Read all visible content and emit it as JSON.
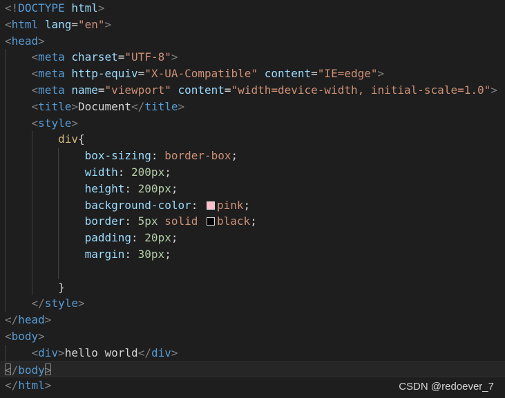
{
  "editor": {
    "lines": [
      {
        "tokens": [
          [
            "punc",
            "<!"
          ],
          [
            "tag",
            "DOCTYPE"
          ],
          [
            "text",
            " "
          ],
          [
            "attr",
            "html"
          ],
          [
            "punc",
            ">"
          ]
        ]
      },
      {
        "tokens": [
          [
            "punc",
            "<"
          ],
          [
            "tag",
            "html"
          ],
          [
            "text",
            " "
          ],
          [
            "attr",
            "lang"
          ],
          [
            "text",
            "="
          ],
          [
            "str",
            "\"en\""
          ],
          [
            "punc",
            ">"
          ]
        ]
      },
      {
        "tokens": [
          [
            "punc",
            "<"
          ],
          [
            "tag",
            "head"
          ],
          [
            "punc",
            ">"
          ]
        ]
      },
      {
        "tokens": [
          [
            "text",
            "    "
          ],
          [
            "punc",
            "<"
          ],
          [
            "tag",
            "meta"
          ],
          [
            "text",
            " "
          ],
          [
            "attr",
            "charset"
          ],
          [
            "text",
            "="
          ],
          [
            "str",
            "\"UTF-8\""
          ],
          [
            "punc",
            ">"
          ]
        ]
      },
      {
        "tokens": [
          [
            "text",
            "    "
          ],
          [
            "punc",
            "<"
          ],
          [
            "tag",
            "meta"
          ],
          [
            "text",
            " "
          ],
          [
            "attr",
            "http-equiv"
          ],
          [
            "text",
            "="
          ],
          [
            "str",
            "\"X-UA-Compatible\""
          ],
          [
            "text",
            " "
          ],
          [
            "attr",
            "content"
          ],
          [
            "text",
            "="
          ],
          [
            "str",
            "\"IE=edge\""
          ],
          [
            "punc",
            ">"
          ]
        ]
      },
      {
        "tokens": [
          [
            "text",
            "    "
          ],
          [
            "punc",
            "<"
          ],
          [
            "tag",
            "meta"
          ],
          [
            "text",
            " "
          ],
          [
            "attr",
            "name"
          ],
          [
            "text",
            "="
          ],
          [
            "str",
            "\"viewport\""
          ],
          [
            "text",
            " "
          ],
          [
            "attr",
            "content"
          ],
          [
            "text",
            "="
          ],
          [
            "str",
            "\"width=device-width, initial-scale=1.0\""
          ],
          [
            "punc",
            ">"
          ]
        ]
      },
      {
        "tokens": [
          [
            "text",
            "    "
          ],
          [
            "punc",
            "<"
          ],
          [
            "tag",
            "title"
          ],
          [
            "punc",
            ">"
          ],
          [
            "text",
            "Document"
          ],
          [
            "punc",
            "</"
          ],
          [
            "tag",
            "title"
          ],
          [
            "punc",
            ">"
          ]
        ]
      },
      {
        "tokens": [
          [
            "text",
            "    "
          ],
          [
            "punc",
            "<"
          ],
          [
            "tag",
            "style"
          ],
          [
            "punc",
            ">"
          ]
        ]
      },
      {
        "tokens": [
          [
            "text",
            "        "
          ],
          [
            "sel",
            "div"
          ],
          [
            "text",
            "{"
          ]
        ]
      },
      {
        "tokens": [
          [
            "text",
            "            "
          ],
          [
            "prop",
            "box-sizing"
          ],
          [
            "text",
            ": "
          ],
          [
            "val",
            "border-box"
          ],
          [
            "text",
            ";"
          ]
        ]
      },
      {
        "tokens": [
          [
            "text",
            "            "
          ],
          [
            "prop",
            "width"
          ],
          [
            "text",
            ": "
          ],
          [
            "num",
            "200px"
          ],
          [
            "text",
            ";"
          ]
        ]
      },
      {
        "tokens": [
          [
            "text",
            "            "
          ],
          [
            "prop",
            "height"
          ],
          [
            "text",
            ": "
          ],
          [
            "num",
            "200px"
          ],
          [
            "text",
            ";"
          ]
        ]
      },
      {
        "tokens": [
          [
            "text",
            "            "
          ],
          [
            "prop",
            "background-color"
          ],
          [
            "text",
            ": "
          ],
          [
            "swatch",
            "pink"
          ],
          [
            "val",
            "pink"
          ],
          [
            "text",
            ";"
          ]
        ]
      },
      {
        "tokens": [
          [
            "text",
            "            "
          ],
          [
            "prop",
            "border"
          ],
          [
            "text",
            ": "
          ],
          [
            "num",
            "5px"
          ],
          [
            "text",
            " "
          ],
          [
            "val",
            "solid"
          ],
          [
            "text",
            " "
          ],
          [
            "swatch",
            "black"
          ],
          [
            "val",
            "black"
          ],
          [
            "text",
            ";"
          ]
        ]
      },
      {
        "tokens": [
          [
            "text",
            "            "
          ],
          [
            "prop",
            "padding"
          ],
          [
            "text",
            ": "
          ],
          [
            "num",
            "20px"
          ],
          [
            "text",
            ";"
          ]
        ]
      },
      {
        "tokens": [
          [
            "text",
            "            "
          ],
          [
            "prop",
            "margin"
          ],
          [
            "text",
            ": "
          ],
          [
            "num",
            "30px"
          ],
          [
            "text",
            ";"
          ]
        ]
      },
      {
        "tokens": [
          [
            "text",
            ""
          ]
        ]
      },
      {
        "tokens": [
          [
            "text",
            "        }"
          ]
        ]
      },
      {
        "tokens": [
          [
            "text",
            "    "
          ],
          [
            "punc",
            "</"
          ],
          [
            "tag",
            "style"
          ],
          [
            "punc",
            ">"
          ]
        ]
      },
      {
        "tokens": [
          [
            "punc",
            "</"
          ],
          [
            "tag",
            "head"
          ],
          [
            "punc",
            ">"
          ]
        ]
      },
      {
        "tokens": [
          [
            "punc",
            "<"
          ],
          [
            "tag",
            "body"
          ],
          [
            "punc",
            ">"
          ]
        ]
      },
      {
        "tokens": [
          [
            "text",
            "    "
          ],
          [
            "punc",
            "<"
          ],
          [
            "tag",
            "div"
          ],
          [
            "punc",
            ">"
          ],
          [
            "text",
            "hello world"
          ],
          [
            "punc",
            "</"
          ],
          [
            "tag",
            "div"
          ],
          [
            "punc",
            ">"
          ]
        ]
      },
      {
        "tokens": [
          [
            "punc",
            "</"
          ],
          [
            "tag",
            "body"
          ],
          [
            "punc",
            ">"
          ]
        ],
        "current": true
      },
      {
        "tokens": [
          [
            "punc",
            "</"
          ],
          [
            "tag",
            "html"
          ],
          [
            "punc",
            ">"
          ]
        ]
      }
    ]
  },
  "colors": {
    "background": "#1e1e1e",
    "pink": "#ffc0cb",
    "black": "#000000"
  },
  "watermark": "CSDN @redoever_7"
}
